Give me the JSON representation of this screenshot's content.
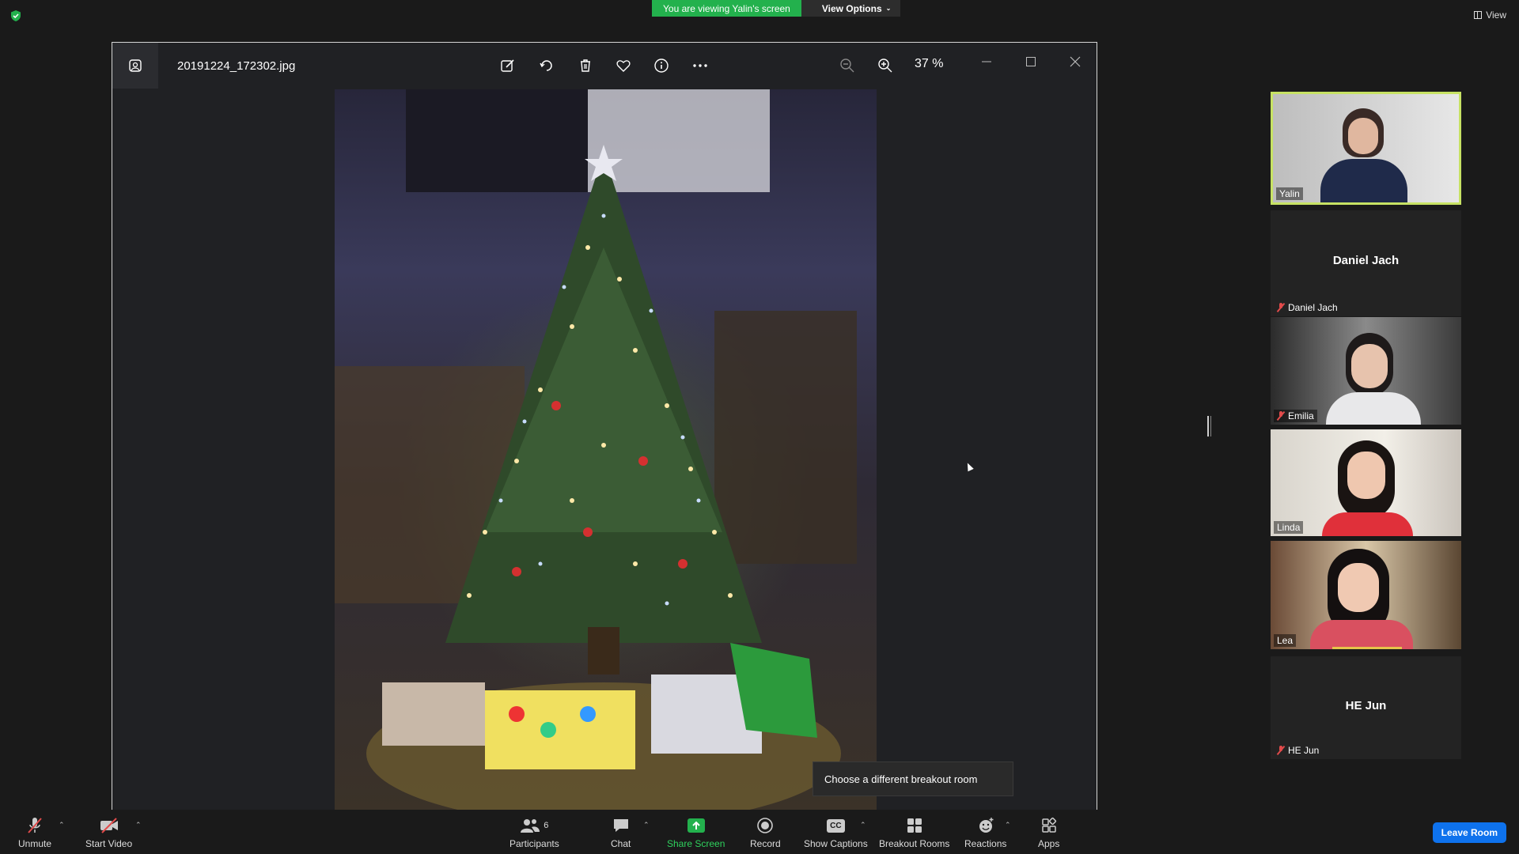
{
  "banner": {
    "viewing_text": "You are viewing Yalin's screen",
    "view_options_label": "View Options"
  },
  "view_label": "View",
  "viewer": {
    "filename": "20191224_172302.jpg",
    "zoom_level": "37 %",
    "tools": [
      "edit-icon",
      "rotate-icon",
      "trash-icon",
      "heart-icon",
      "info-icon",
      "more-icon",
      "zoom-out-icon",
      "zoom-in-icon"
    ]
  },
  "tooltip": "Choose a different breakout room",
  "participants": {
    "tiles": [
      {
        "name": "Yalin",
        "video": true,
        "active_speaker": true,
        "muted": false
      },
      {
        "name": "Daniel Jach",
        "video": false,
        "muted": true
      },
      {
        "name": "Emilia",
        "video": true,
        "muted": true
      },
      {
        "name": "Linda",
        "video": true,
        "muted": false
      },
      {
        "name": "Lea",
        "video": true,
        "muted": false
      },
      {
        "name": "HE Jun",
        "video": false,
        "muted": true
      }
    ]
  },
  "toolbar": {
    "unmute": "Unmute",
    "start_video": "Start Video",
    "participants": "Participants",
    "participants_count": "6",
    "chat": "Chat",
    "share_screen": "Share Screen",
    "record": "Record",
    "show_captions": "Show Captions",
    "captions_icon_text": "CC",
    "breakout_rooms": "Breakout Rooms",
    "reactions": "Reactions",
    "apps": "Apps",
    "leave_room": "Leave Room"
  },
  "colors": {
    "banner_green": "#23b14d",
    "active_border": "#c7e264",
    "leave_blue": "#0e72ed",
    "share_green": "#2fd15d",
    "muted_red": "#e24b4b"
  }
}
